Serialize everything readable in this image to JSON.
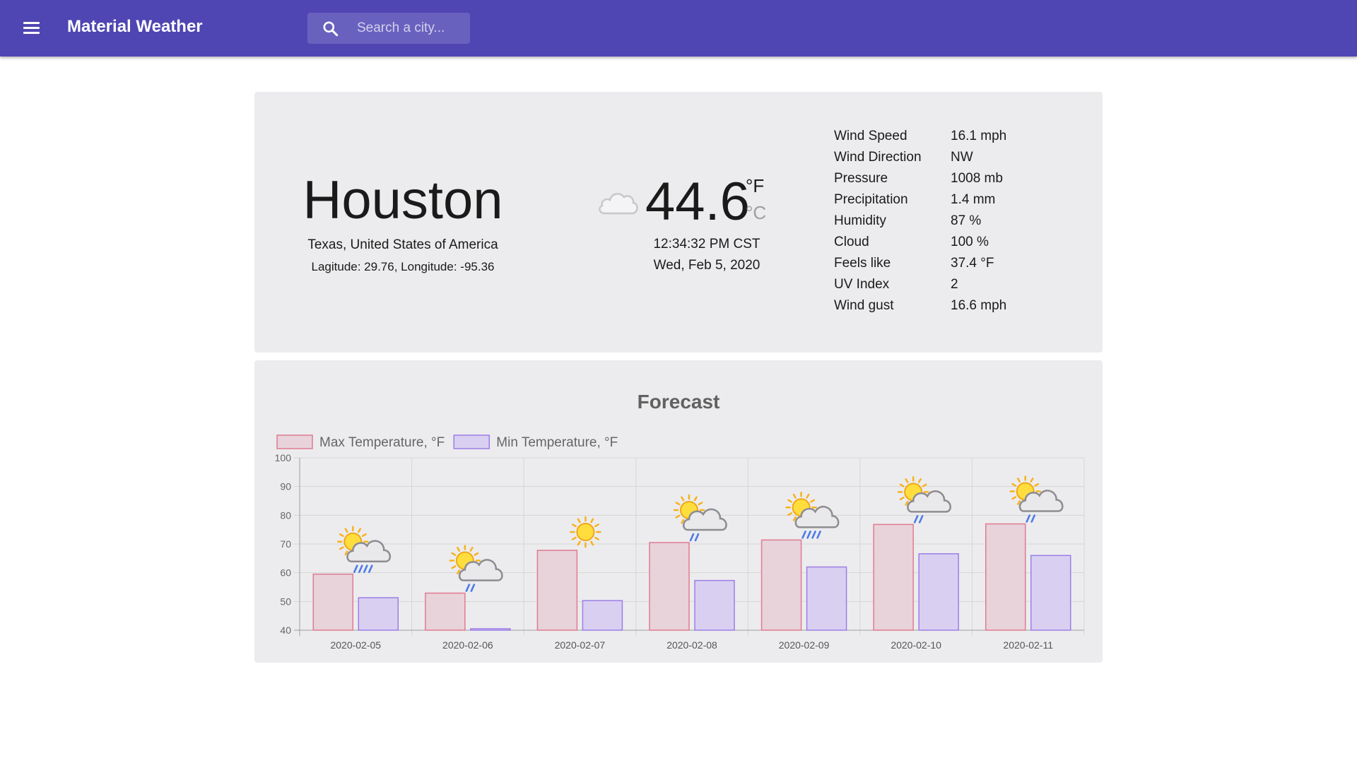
{
  "app": {
    "title": "Material Weather"
  },
  "search": {
    "placeholder": "Search a city..."
  },
  "current": {
    "city": "Houston",
    "region": "Texas, United States of America",
    "coordinates": "Lagitude: 29.76, Longitude: -95.36",
    "condition_icon": "cloud-icon",
    "temperature": "44.6",
    "unit_f": "°F",
    "unit_c": "°C",
    "time": "12:34:32 PM CST",
    "date": "Wed, Feb 5, 2020",
    "details": [
      {
        "label": "Wind Speed",
        "value": "16.1 mph"
      },
      {
        "label": "Wind Direction",
        "value": "NW"
      },
      {
        "label": "Pressure",
        "value": "1008 mb"
      },
      {
        "label": "Precipitation",
        "value": "1.4 mm"
      },
      {
        "label": "Humidity",
        "value": "87 %"
      },
      {
        "label": "Cloud",
        "value": "100 %"
      },
      {
        "label": "Feels like",
        "value": "37.4 °F"
      },
      {
        "label": "UV Index",
        "value": "2"
      },
      {
        "label": "Wind gust",
        "value": "16.6 mph"
      }
    ]
  },
  "chart_data": {
    "type": "bar",
    "title": "Forecast",
    "categories": [
      "2020-02-05",
      "2020-02-06",
      "2020-02-07",
      "2020-02-08",
      "2020-02-09",
      "2020-02-10",
      "2020-02-11"
    ],
    "series": [
      {
        "name": "Max Temperature, °F",
        "values": [
          59.5,
          52.9,
          67.8,
          70.5,
          71.4,
          76.8,
          77.0
        ],
        "color": "#e8d3da",
        "border": "#e07a93"
      },
      {
        "name": "Min Temperature, °F",
        "values": [
          51.3,
          40.5,
          50.3,
          57.3,
          62.0,
          66.6,
          66.0
        ],
        "color": "#d9d0f1",
        "border": "#9b7ee6"
      }
    ],
    "day_icons": [
      "sun-cloud-heavy-rain-icon",
      "sun-cloud-light-rain-icon",
      "sun-icon",
      "sun-cloud-light-rain-icon",
      "sun-cloud-heavy-rain-icon",
      "sun-cloud-light-rain-icon",
      "sun-cloud-light-rain-icon"
    ],
    "ylim": [
      40,
      100
    ],
    "yticks": [
      40,
      50,
      60,
      70,
      80,
      90,
      100
    ],
    "grid": true,
    "legend": "top-left",
    "xlabel": "",
    "ylabel": ""
  }
}
